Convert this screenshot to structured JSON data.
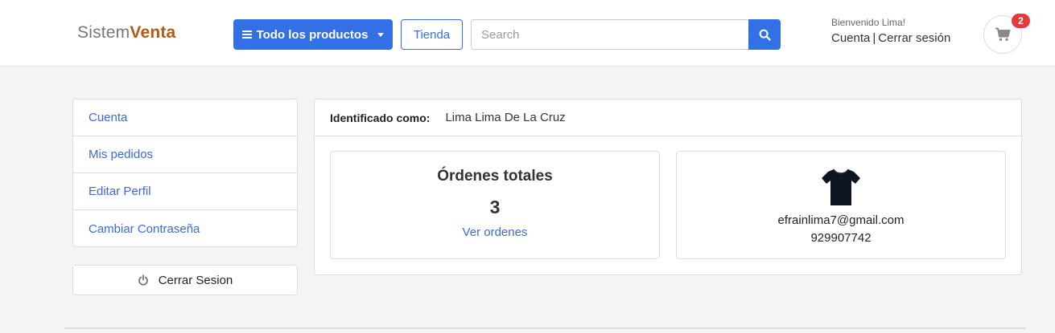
{
  "header": {
    "logo_part1": "Sistem",
    "logo_part2": "Venta",
    "products_button": "Todo los productos",
    "store_button": "Tienda",
    "search_placeholder": "Search",
    "welcome": "Bienvenido Lima!",
    "account_link": "Cuenta",
    "separator": "|",
    "logout_link": "Cerrar sesión",
    "cart_count": "2"
  },
  "sidebar": {
    "items": [
      {
        "label": "Cuenta"
      },
      {
        "label": "Mis pedidos"
      },
      {
        "label": "Editar Perfil"
      },
      {
        "label": "Cambiar Contraseña"
      }
    ],
    "logout_button": "Cerrar Sesion"
  },
  "profile": {
    "identified_label": "Identificado como:",
    "identified_name": "Lima Lima De La Cruz",
    "orders_title": "Órdenes totales",
    "orders_count": "3",
    "orders_link": "Ver ordenes",
    "email": "efrainlima7@gmail.com",
    "phone": "929907742"
  },
  "colors": {
    "primary": "#3370e6",
    "brand": "#b45a16",
    "badge": "#e53a3a",
    "link": "#3a6bd8"
  },
  "icons": {
    "menu": "bars-icon",
    "dropdown": "caret-down-icon",
    "search": "search-icon",
    "cart": "shopping-cart-icon",
    "logout": "power-icon",
    "avatar": "tshirt-icon"
  }
}
